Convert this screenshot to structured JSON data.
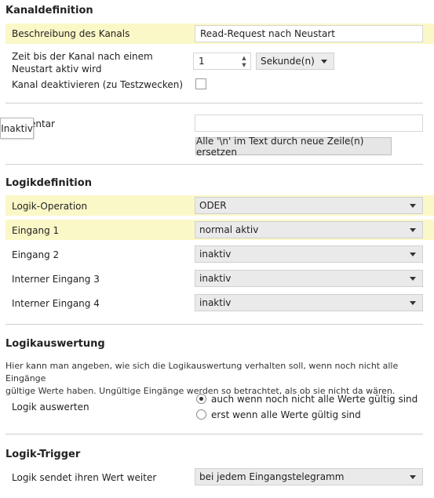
{
  "kanal": {
    "title": "Kanaldefinition",
    "beschreibung_label": "Beschreibung des Kanals",
    "beschreibung_value": "Read-Request nach Neustart",
    "zeit_label_line1": "Zeit bis der Kanal nach einem",
    "zeit_label_line2": "Neustart aktiv wird",
    "zeit_value": "1",
    "zeit_unit": "Sekunde(n)",
    "deaktivieren_label": "Kanal deaktivieren (zu Testzwecken)",
    "deaktivieren_checked": false,
    "kommentar_label": "entar",
    "kommentar_value": "",
    "replace_button": "Alle '\\n' im Text durch neue Zeile(n) ersetzen",
    "tooltip": "Inaktiv"
  },
  "logik": {
    "title": "Logikdefinition",
    "rows": [
      {
        "label": "Logik-Operation",
        "value": "ODER"
      },
      {
        "label": "Eingang 1",
        "value": "normal aktiv"
      },
      {
        "label": "Eingang 2",
        "value": "inaktiv"
      },
      {
        "label": "Interner Eingang 3",
        "value": "inaktiv"
      },
      {
        "label": "Interner Eingang 4",
        "value": "inaktiv"
      }
    ]
  },
  "auswertung": {
    "title": "Logikauswertung",
    "description_line1": "Hier kann man angeben, wie sich die Logikauswertung verhalten soll, wenn noch nicht alle Eingänge",
    "description_line2": "gültige Werte haben. Ungültige Eingänge werden so betrachtet, als ob sie nicht da wären.",
    "label": "Logik auswerten",
    "options": [
      "auch wenn noch nicht alle Werte gültig sind",
      "erst wenn alle Werte gültig sind"
    ],
    "selected": "auch wenn noch nicht alle Werte gültig sind"
  },
  "trigger": {
    "title": "Logik-Trigger",
    "label": "Logik sendet ihren Wert weiter",
    "value": "bei jedem Eingangstelegramm"
  },
  "colors": {
    "highlight": "#fbf8c8",
    "select_bg": "#eaeaea",
    "separator": "#cfcfcf"
  }
}
